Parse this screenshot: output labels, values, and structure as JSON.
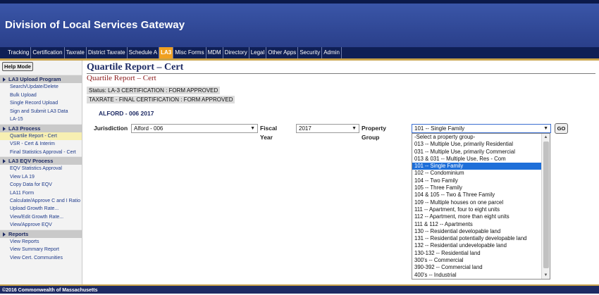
{
  "header": {
    "title": "Division of Local Services Gateway"
  },
  "nav": {
    "items": [
      "Tracking",
      "Certification",
      "Taxrate",
      "District Taxrate",
      "Schedule A",
      "LA3",
      "Misc Forms",
      "MDM",
      "Directory",
      "Legal",
      "Other Apps",
      "Security",
      "Admin"
    ],
    "active": "LA3"
  },
  "sidebar": {
    "help_mode": "Help Mode",
    "sections": [
      {
        "title": "LA3 Upload Program",
        "items": [
          "Search/Update/Delete",
          "Bulk Upload",
          "Single Record Upload",
          "Sign and Submit LA3 Data",
          "LA-15"
        ]
      },
      {
        "title": "LA3 Process",
        "items": [
          "Quartile Report - Cert",
          "VSR - Cert & Interim",
          "Final Statistics Approval - Cert"
        ]
      },
      {
        "title": "LA3 EQV Process",
        "items": [
          "EQV Statistics Approval",
          "View LA 19",
          "Copy Data for EQV",
          "LA11 Form",
          "Calculate/Approve C and I Ratio",
          "Upload Growth Rate...",
          "View/Edit Growth Rate...",
          "View/Approve EQV"
        ]
      },
      {
        "title": "Reports",
        "items": [
          "View Reports",
          "View Summary Report",
          "View Cert. Communities"
        ]
      }
    ]
  },
  "main": {
    "title": "Quartile Report – Cert",
    "subtitle": "Quartile Report – Cert",
    "status_cert": "Status: LA-3 CERTIFICATION : FORM APPROVED",
    "status_taxrate": "TAXRATE - FINAL CERTIFICATION : FORM APPROVED",
    "town": "ALFORD - 006 2017",
    "jurisdiction_label": "Jurisdiction",
    "jurisdiction_value": "Alford - 006",
    "fiscal_year_label": "Fiscal Year",
    "fiscal_year_value": "2017",
    "property_group_label": "Property Group",
    "property_group_value": "101 -- Single Family",
    "go_label": "GO"
  },
  "dropdown": {
    "options": [
      "-Select a property group-",
      "013 -- Multiple Use, primarily Residential",
      "031 -- Multiple Use, primarily Commercial",
      "013 & 031 -- Multiple Use, Res - Com",
      "101 -- Single Family",
      "102 -- Condominium",
      "104 -- Two Family",
      "105 -- Three Family",
      "104 & 105 -- Two & Three Family",
      "109 -- Multiple houses on one parcel",
      "111 -- Apartment, four to eight units",
      "112 -- Apartment, more than eight units",
      "111 & 112 -- Apartments",
      "130 -- Residential developable land",
      "131 -- Residential potentially developable land",
      "132 -- Residential undevelopable land",
      "130-132 -- Residential land",
      "300's -- Commercial",
      "390-392 -- Commercial land",
      "400's -- Industrial"
    ],
    "highlighted_index": 4
  },
  "footer": {
    "text": "©2016 Commonwealth of Massachusetts"
  },
  "colors": {
    "header": "#2a3f8a",
    "nav": "#0f1f55",
    "active_tab": "#f0a020",
    "highlight": "#1e6fd9",
    "title": "#1d2a63",
    "subtitle": "#8b1a1a"
  }
}
